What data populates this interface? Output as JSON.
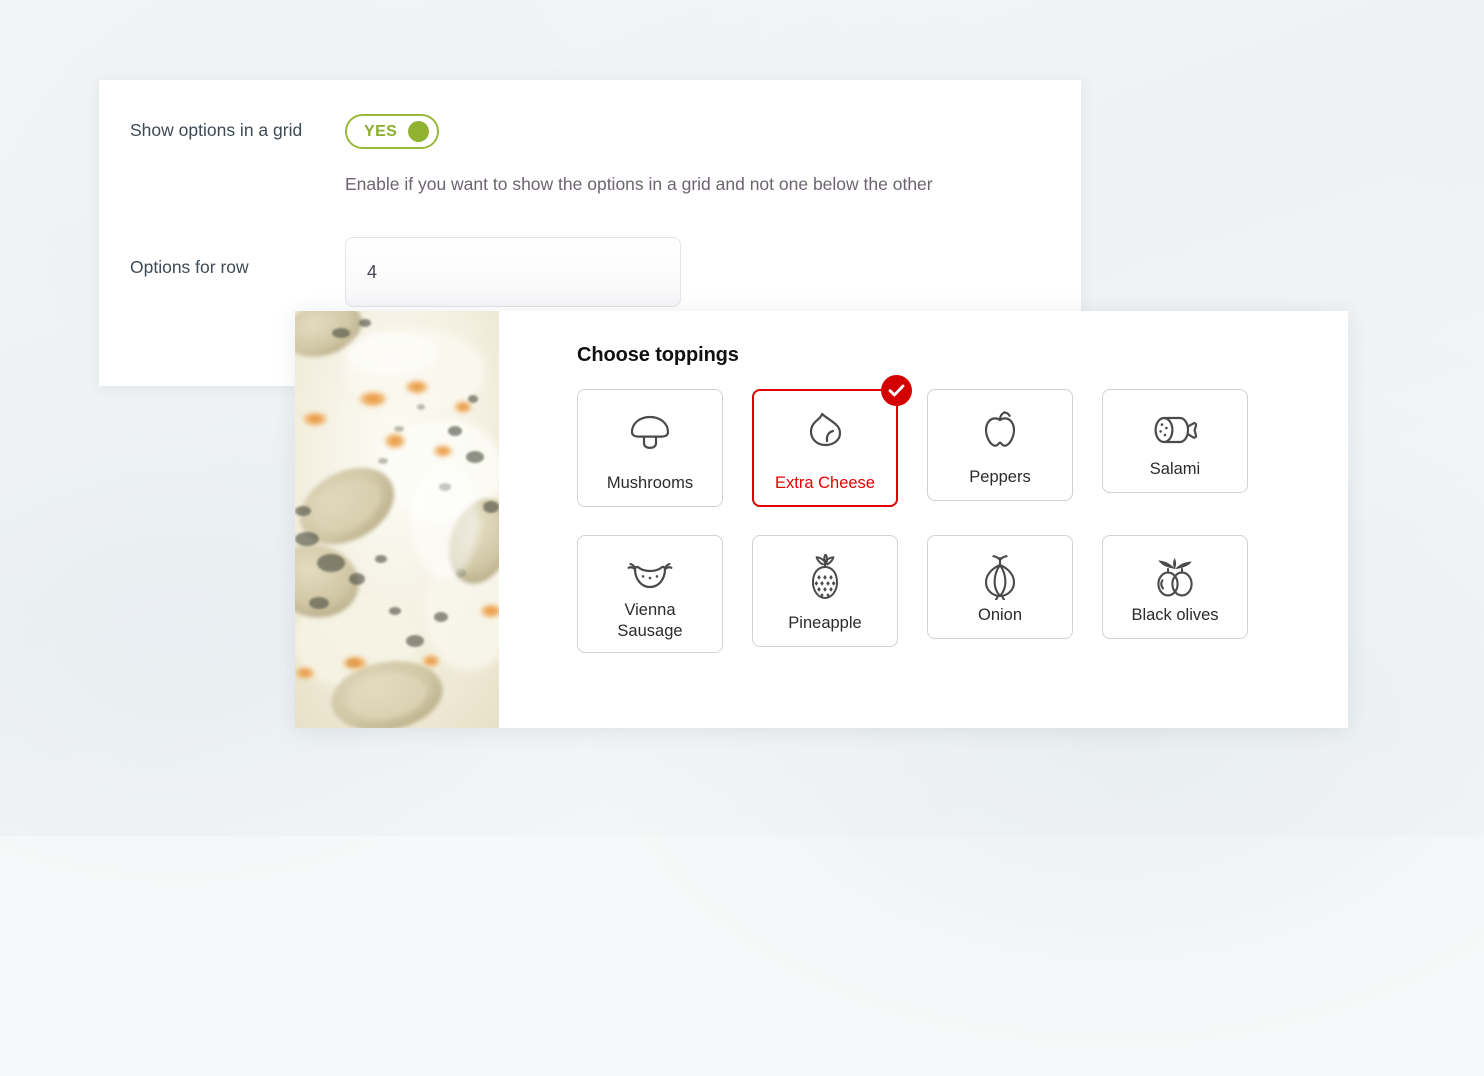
{
  "settings": {
    "grid_toggle": {
      "label": "Show options in a grid",
      "value_text": "YES",
      "help": "Enable if you want to show the options in a grid and not one below the other",
      "accent_color": "#92b332"
    },
    "options_for_row": {
      "label": "Options for row",
      "value": "4",
      "placeholder": "4"
    }
  },
  "preview": {
    "title": "Choose toppings",
    "selected_color": "#e00000",
    "image": "pizza-closeup-photo",
    "toppings": [
      {
        "label": "Mushrooms",
        "icon": "mushroom-icon",
        "selected": false
      },
      {
        "label": "Extra Cheese",
        "icon": "cheese-drop-icon",
        "selected": true
      },
      {
        "label": "Peppers",
        "icon": "bell-pepper-icon",
        "selected": false
      },
      {
        "label": "Salami",
        "icon": "salami-icon",
        "selected": false
      },
      {
        "label": "Vienna\nSausage",
        "icon": "sausage-icon",
        "selected": false
      },
      {
        "label": "Pineapple",
        "icon": "pineapple-icon",
        "selected": false
      },
      {
        "label": "Onion",
        "icon": "onion-icon",
        "selected": false
      },
      {
        "label": "Black olives",
        "icon": "olives-icon",
        "selected": false
      }
    ]
  }
}
